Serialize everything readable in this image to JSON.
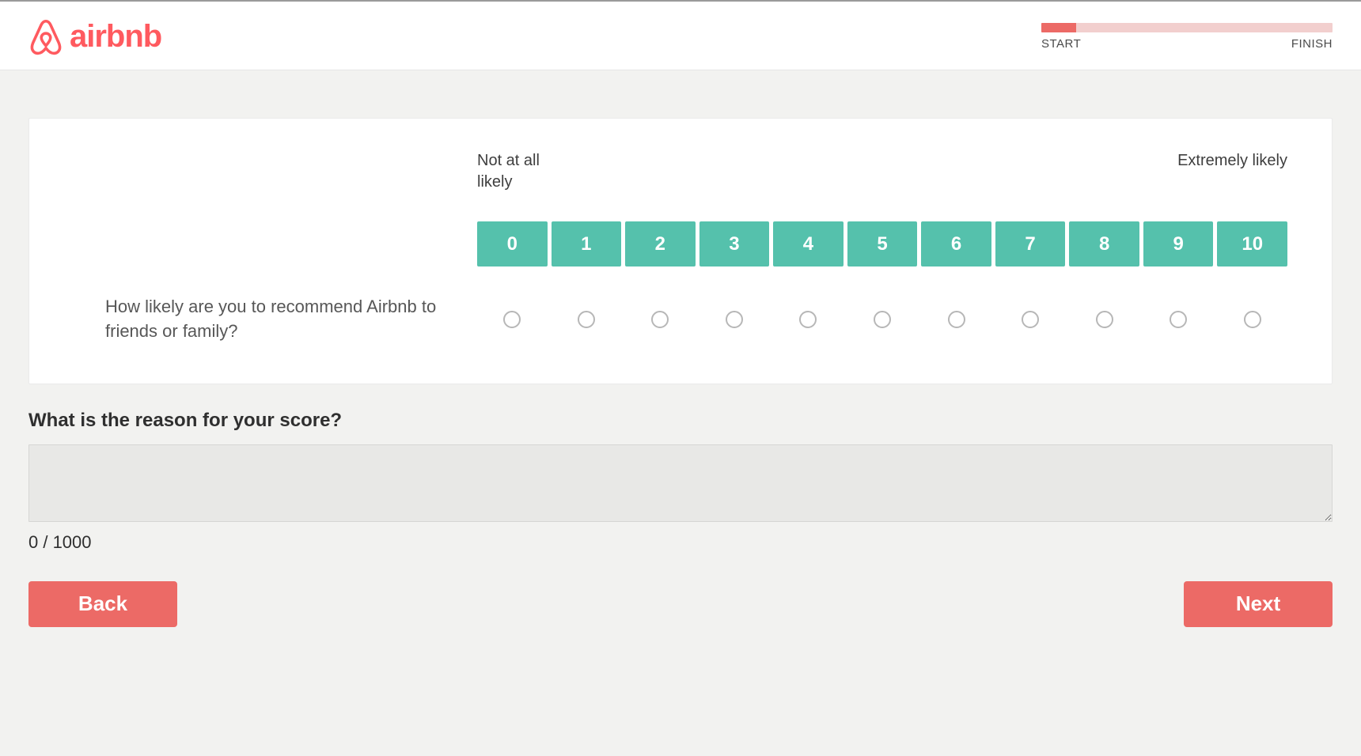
{
  "brand": {
    "name": "airbnb"
  },
  "progress": {
    "start_label": "START",
    "finish_label": "FINISH",
    "percent": 12
  },
  "nps": {
    "anchor_low": "Not at all likely",
    "anchor_high": "Extremely likely",
    "scale": [
      "0",
      "1",
      "2",
      "3",
      "4",
      "5",
      "6",
      "7",
      "8",
      "9",
      "10"
    ],
    "question": "How likely are you to recommend Airbnb to friends or family?"
  },
  "reason": {
    "label": "What is the reason for your score?",
    "value": "",
    "count_display": "0 / 1000",
    "max": 1000
  },
  "nav": {
    "back": "Back",
    "next": "Next"
  }
}
